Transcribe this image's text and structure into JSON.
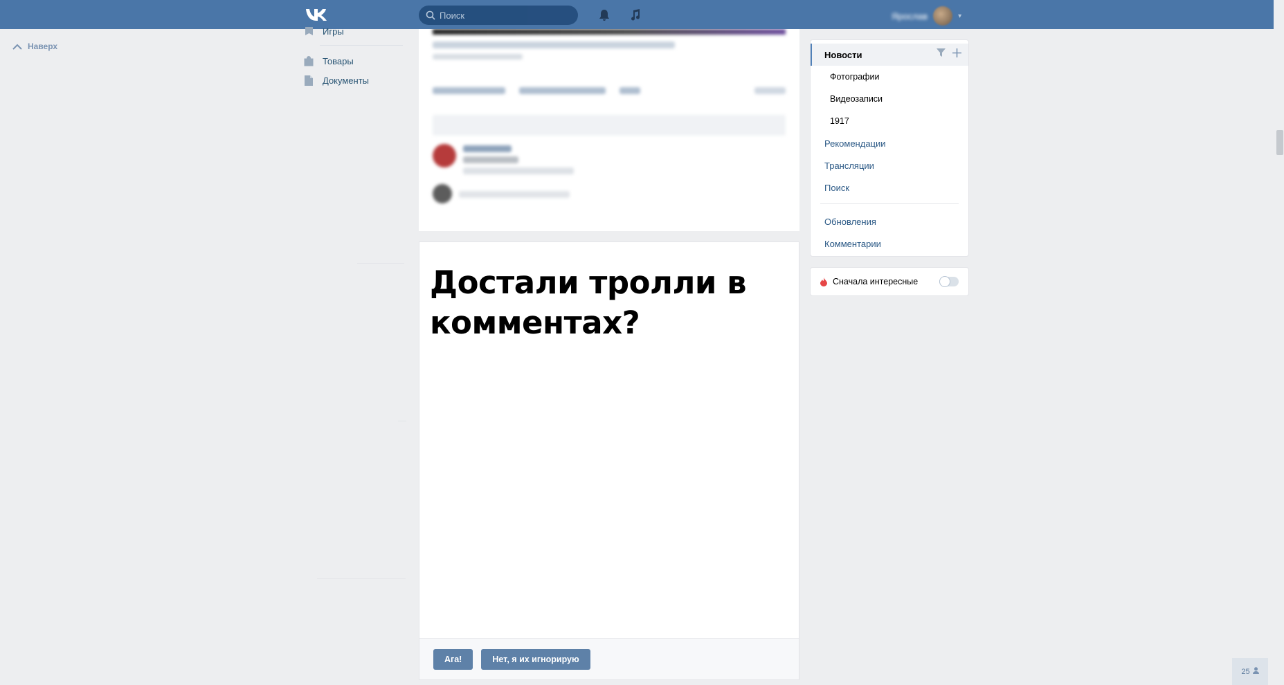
{
  "header": {
    "search_placeholder": "Поиск",
    "profile_name": "Ярослав",
    "icons": [
      "vk-logo-icon",
      "search-icon",
      "bell-icon",
      "music-icon",
      "chevron-down-icon"
    ]
  },
  "up_button": {
    "label": "Наверх"
  },
  "left_menu": {
    "items": [
      {
        "label": "Игры",
        "icon": "games-icon"
      },
      {
        "label": "Товары",
        "icon": "shopping-bag-icon"
      },
      {
        "label": "Документы",
        "icon": "document-icon"
      }
    ]
  },
  "poll": {
    "title": "Достали тролли в комментах?",
    "buttons": [
      "Ага!",
      "Нет, я их игнорирую"
    ]
  },
  "news_filter": {
    "active": "Новости",
    "subitems": [
      "Фотографии",
      "Видеозаписи",
      "1917"
    ],
    "items": [
      "Рекомендации",
      "Трансляции",
      "Поиск"
    ],
    "items2": [
      "Обновления",
      "Комментарии"
    ]
  },
  "interesting_first": {
    "label": "Сначала интересные",
    "enabled": false
  },
  "online_counter": {
    "value": "25"
  },
  "colors": {
    "header": "#4a76a8",
    "button": "#5e81a8",
    "link": "#2a5885",
    "background": "#edeef0"
  }
}
